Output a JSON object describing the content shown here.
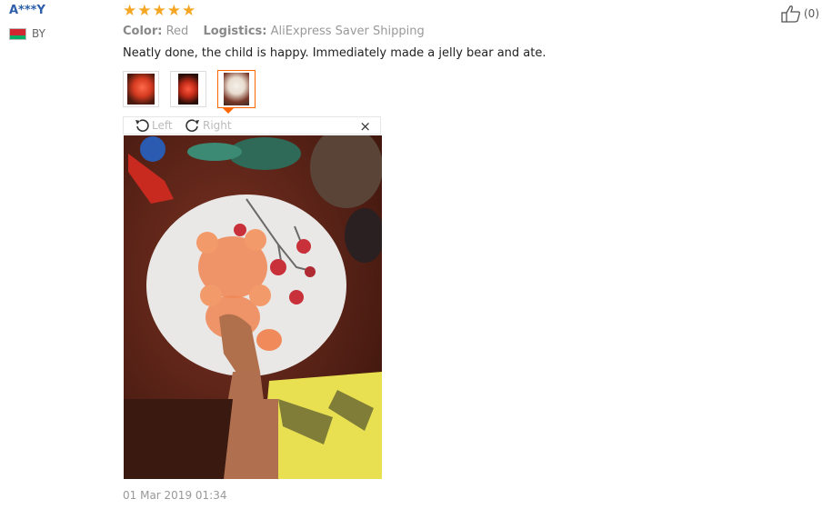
{
  "review": {
    "user_name": "A***Y",
    "country": "BY",
    "stars": [
      "★",
      "★",
      "★",
      "★",
      "★"
    ],
    "color_key": "Color:",
    "color_value": "Red",
    "logistics_key": "Logistics:",
    "logistics_value": "AliExpress Saver Shipping",
    "text": "Neatly done, the child is happy. Immediately made a jelly bear and ate.",
    "date": "01 Mar 2019 01:34",
    "likes": "(0)"
  },
  "viewer": {
    "rotate_left_label": "Left",
    "rotate_right_label": "Right",
    "close_label": "×"
  },
  "colors": {
    "star": "#f5a623",
    "accent": "#ff6600",
    "username": "#2e5faa"
  }
}
